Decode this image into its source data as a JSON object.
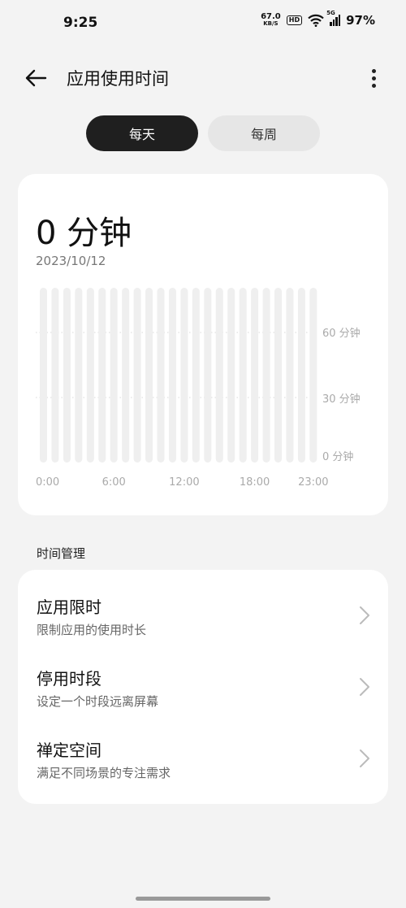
{
  "status_bar": {
    "time": "9:25",
    "net_speed_value": "67.0",
    "net_speed_unit": "KB/S",
    "hd_label": "HD",
    "signal_tag": "5G",
    "battery": "97%",
    "icons": [
      "hd-icon",
      "wifi-icon",
      "signal-icon"
    ]
  },
  "header": {
    "title": "应用使用时间",
    "back_icon": "arrow-left-icon",
    "more_icon": "more-vertical-icon"
  },
  "tabs": [
    {
      "label": "每天",
      "selected": true
    },
    {
      "label": "每周",
      "selected": false
    }
  ],
  "usage": {
    "total": "0 分钟",
    "date": "2023/10/12"
  },
  "chart_data": {
    "type": "bar",
    "categories": [
      "0",
      "1",
      "2",
      "3",
      "4",
      "5",
      "6",
      "7",
      "8",
      "9",
      "10",
      "11",
      "12",
      "13",
      "14",
      "15",
      "16",
      "17",
      "18",
      "19",
      "20",
      "21",
      "22",
      "23"
    ],
    "values": [
      0,
      0,
      0,
      0,
      0,
      0,
      0,
      0,
      0,
      0,
      0,
      0,
      0,
      0,
      0,
      0,
      0,
      0,
      0,
      0,
      0,
      0,
      0,
      0
    ],
    "x_tick_labels": [
      "0:00",
      "6:00",
      "12:00",
      "18:00",
      "23:00"
    ],
    "x_tick_indices": [
      0,
      6,
      12,
      18,
      23
    ],
    "y_tick_labels": [
      "60 分钟",
      "30 分钟",
      "0 分钟"
    ],
    "y_ticks": [
      60,
      30,
      0
    ],
    "ylim": [
      0,
      60
    ],
    "grid": true,
    "track_color": "#efefef",
    "grid_color": "#d8d8d8"
  },
  "time_management": {
    "section_title": "时间管理",
    "items": [
      {
        "title": "应用限时",
        "subtitle": "限制应用的使用时长"
      },
      {
        "title": "停用时段",
        "subtitle": "设定一个时段远离屏幕"
      },
      {
        "title": "禅定空间",
        "subtitle": "满足不同场景的专注需求"
      }
    ],
    "chevron_icon": "chevron-right-icon"
  }
}
